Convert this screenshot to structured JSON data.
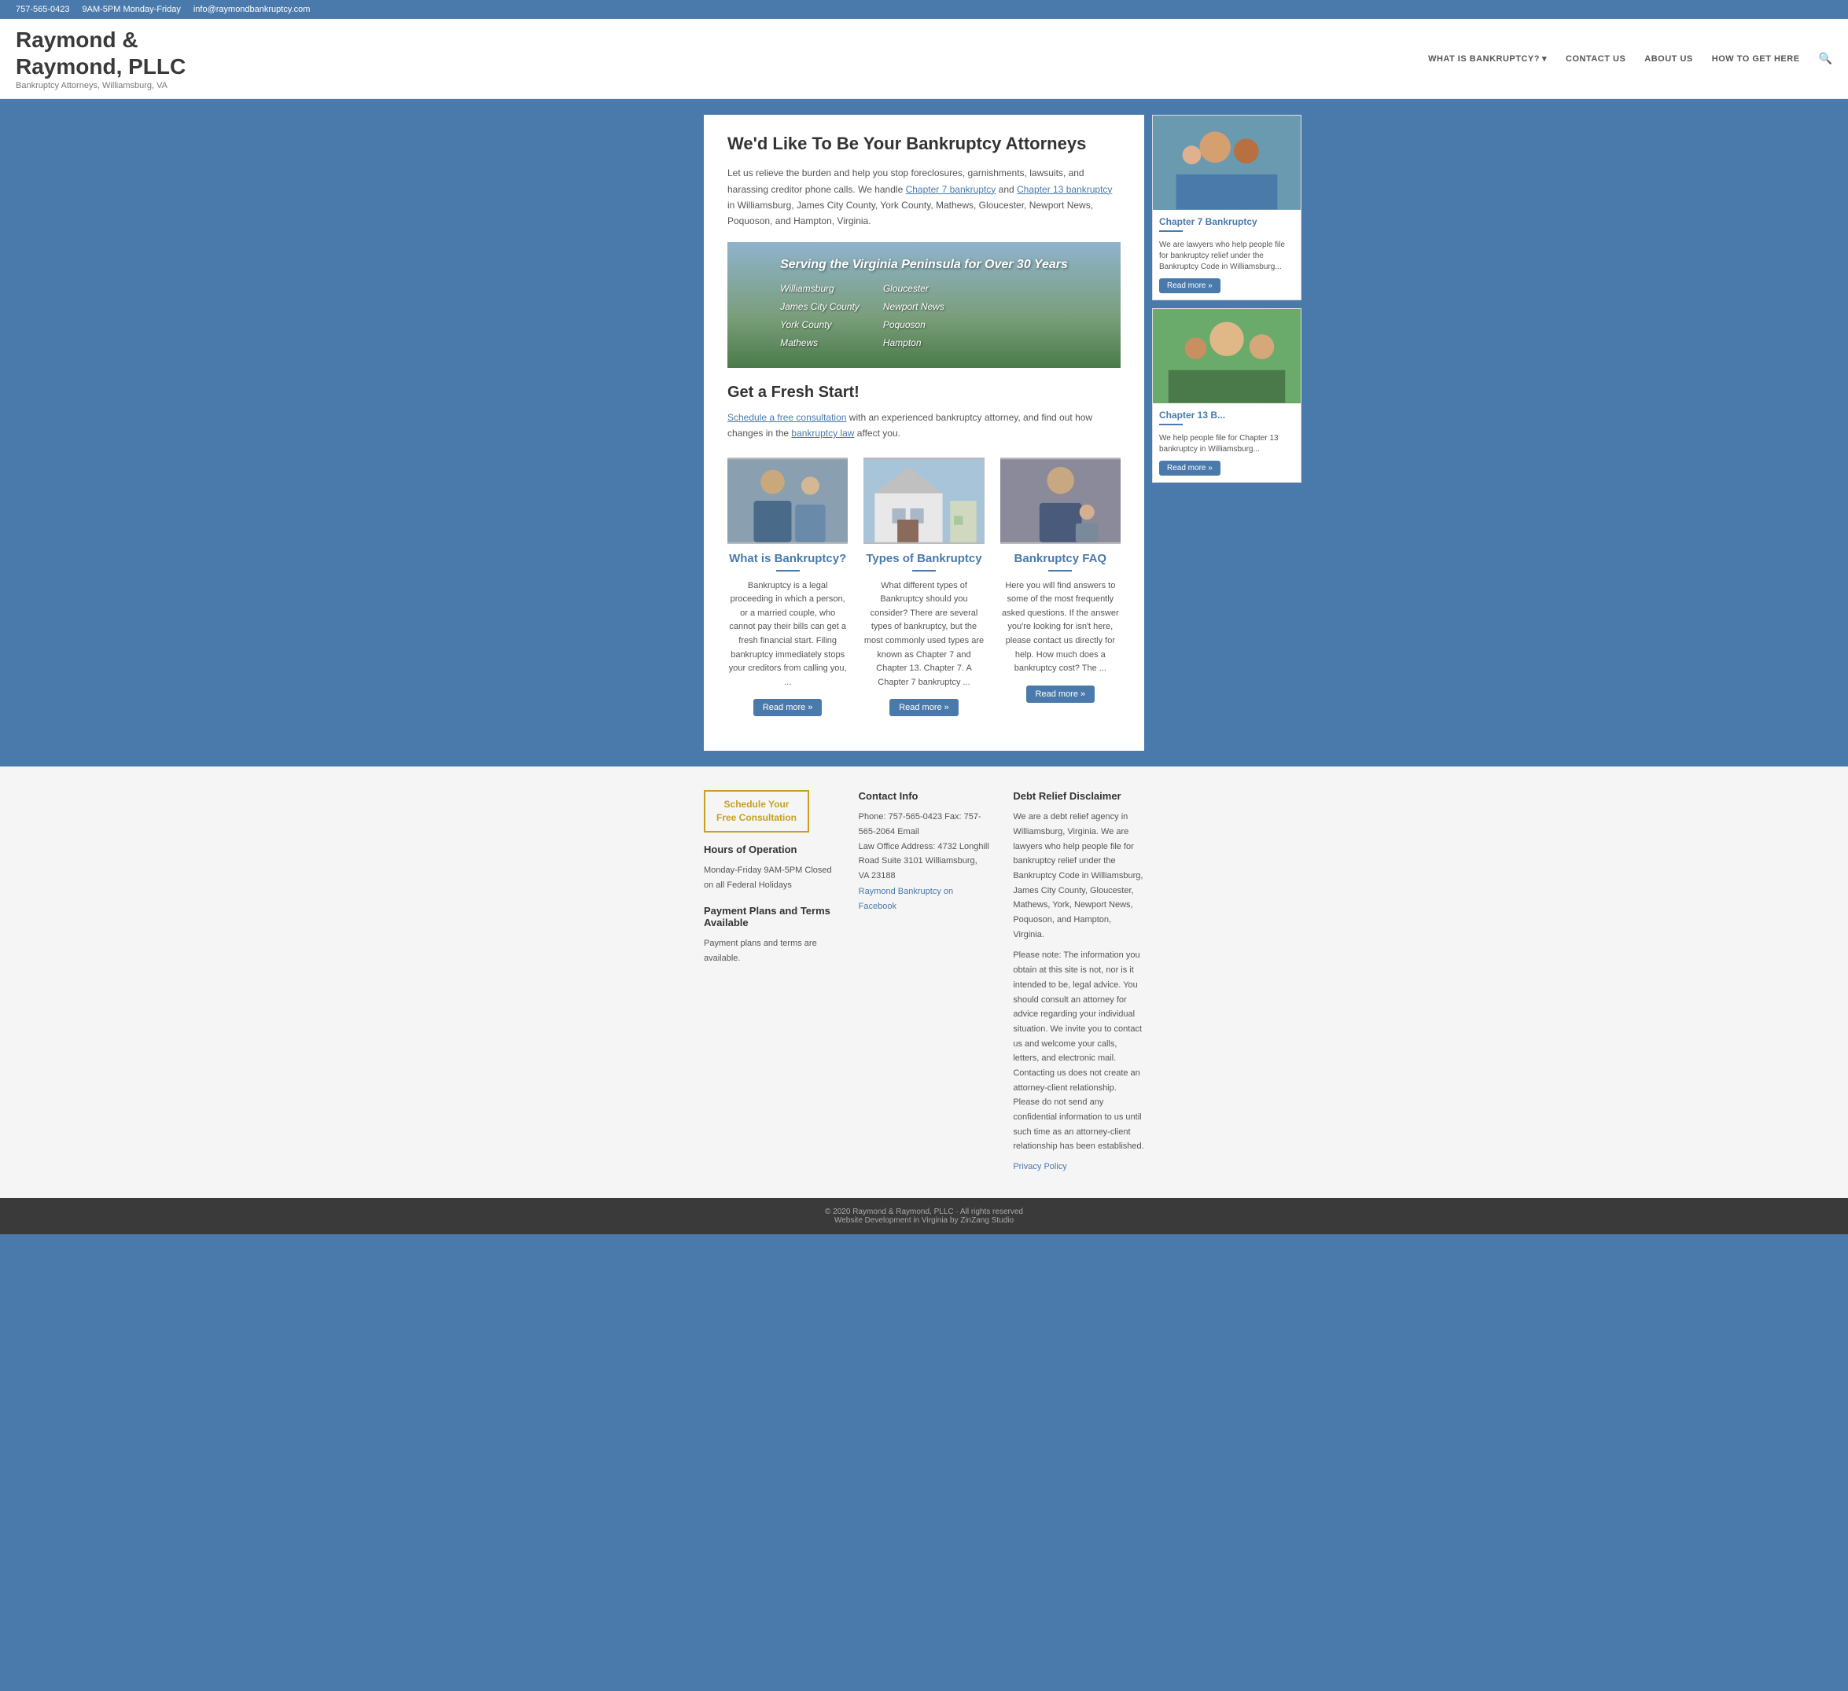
{
  "topbar": {
    "phone": "757-565-0423",
    "hours": "9AM-5PM Monday-Friday",
    "email": "info@raymondbankruptcy.com"
  },
  "header": {
    "logo_line1": "Raymond &",
    "logo_line2": "Raymond, PLLC",
    "tagline": "Bankruptcy Attorneys, Williamsburg, VA",
    "nav": [
      {
        "label": "WHAT IS BANKRUPTCY?",
        "has_dropdown": true
      },
      {
        "label": "CONTACT US",
        "has_dropdown": false
      },
      {
        "label": "ABOUT US",
        "has_dropdown": false
      },
      {
        "label": "HOW TO GET HERE",
        "has_dropdown": false
      }
    ]
  },
  "hero": {
    "title": "We'd Like To Be Your Bankruptcy Attorneys",
    "text": "Let us relieve the burden and help you stop foreclosures, garnishments, lawsuits, and harassing creditor phone calls. We handle ",
    "link1_text": "Chapter 7 bankruptcy",
    "link1_url": "#",
    "text2": " and ",
    "link2_text": "Chapter 13 bankruptcy",
    "link2_url": "#",
    "text3": " in Williamsburg, James City County, York County, Mathews, Gloucester, Newport News, Poquoson, and Hampton, Virginia."
  },
  "banner": {
    "tagline": "Serving the Virginia Peninsula for Over 30 Years",
    "cities_left": [
      "Williamsburg",
      "James City County",
      "York County",
      "Mathews"
    ],
    "cities_right": [
      "Gloucester",
      "Newport News",
      "Poquoson",
      "Hampton"
    ]
  },
  "fresh_start": {
    "title": "Get a Fresh Start!",
    "link_text": "Schedule a free consultation",
    "link_url": "#",
    "text": " with an experienced bankruptcy attorney, and find out how changes in the ",
    "link2_text": "bankruptcy law",
    "link2_url": "#",
    "text2": " affect you."
  },
  "cards": [
    {
      "title": "What is Bankruptcy?",
      "text": "Bankruptcy is a legal proceeding in which a person, or a married couple, who cannot pay their bills can get a fresh financial start. Filing bankruptcy immediately stops your creditors from calling you, ...",
      "btn_label": "Read more »"
    },
    {
      "title": "Types of Bankruptcy",
      "text": "What different types of Bankruptcy should you consider? There are several types of bankruptcy, but the most commonly used types are known as Chapter 7 and Chapter 13. Chapter 7. A Chapter 7 bankruptcy ...",
      "btn_label": "Read more »"
    },
    {
      "title": "Bankruptcy FAQ",
      "text": "Here you will find answers to some of the most frequently asked questions. If the answer you're looking for isn't here, please contact us directly for help. How much does a bankruptcy cost? The ...",
      "btn_label": "Read more »"
    }
  ],
  "side_cards": [
    {
      "title": "Chapter 7 Bankruptcy",
      "text": "We are lawyers who help people file for bankruptcy relief under the Bankruptcy Code in Williamsburg...",
      "btn_label": "Read more »"
    },
    {
      "title": "Chapter 13 B...",
      "text": "We help people file for Chapter 13 bankruptcy in Williamsburg...",
      "btn_label": "Read more »"
    }
  ],
  "footer": {
    "schedule_btn_line1": "Schedule Your",
    "schedule_btn_line2": "Free Consultation",
    "hours_title": "Hours of Operation",
    "hours_text": "Monday-Friday 9AM-5PM Closed on all Federal Holidays",
    "payment_title": "Payment Plans and Terms Available",
    "payment_text": "Payment plans and terms are available.",
    "contact_title": "Contact Info",
    "contact_text": "Phone: 757-565-0423 Fax: 757-565-2064 Email",
    "contact_address": "Law Office Address: 4732 Longhill Road Suite 3101 Williamsburg, VA 23188",
    "contact_facebook": "Raymond Bankruptcy on Facebook",
    "disclaimer_title": "Debt Relief Disclaimer",
    "disclaimer_text1": "We are a debt relief agency in Williamsburg, Virginia. We are lawyers who help people file for bankruptcy relief under the Bankruptcy Code in Williamsburg, James City County, Gloucester, Mathews, York, Newport News, Poquoson, and Hampton, Virginia.",
    "disclaimer_text2": "Please note: The information you obtain at this site is not, nor is it intended to be, legal advice. You should consult an attorney for advice regarding your individual situation. We invite you to contact us and welcome your calls, letters, and electronic mail. Contacting us does not create an attorney-client relationship. Please do not send any confidential information to us until such time as an attorney-client relationship has been established.",
    "privacy_link": "Privacy Policy",
    "bottom_copyright": "© 2020 Raymond & Raymond, PLLC · All rights reserved",
    "bottom_dev": "Website Development in Virginia by ZinZang Studio"
  }
}
